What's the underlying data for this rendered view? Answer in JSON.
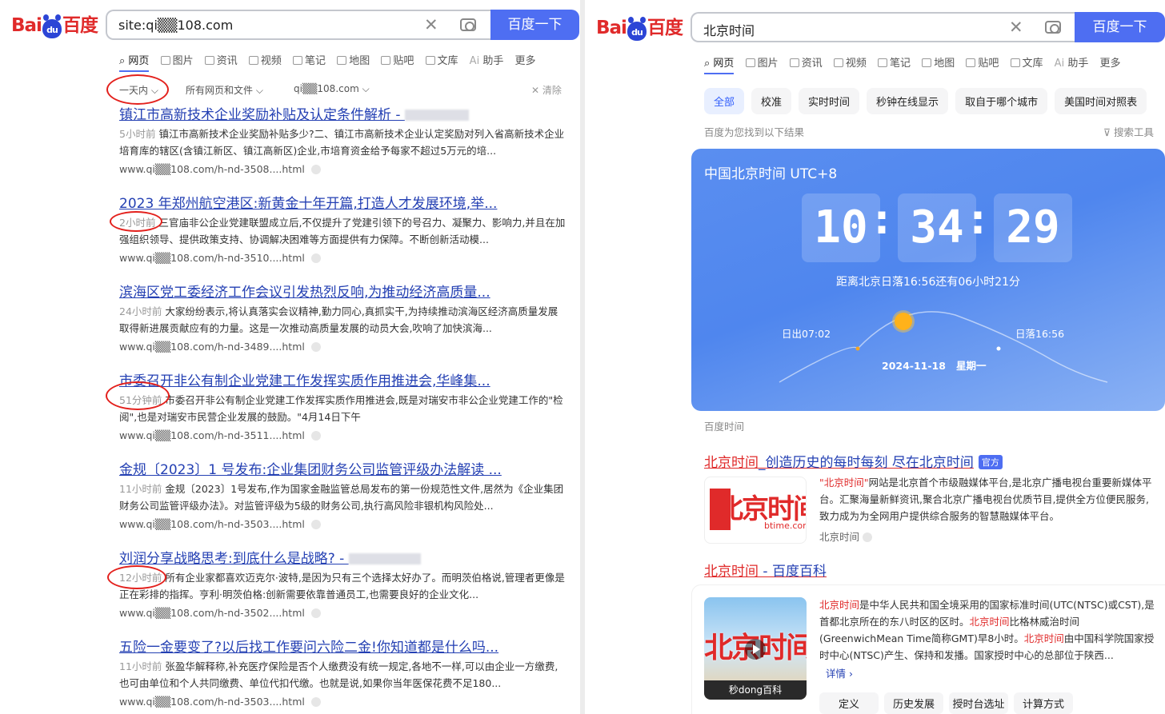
{
  "logo": {
    "part1": "Bai",
    "paw": "du",
    "part2": "百度"
  },
  "left": {
    "query": "site:qi▒▒108.com",
    "search_button": "百度一下",
    "tabs": [
      "网页",
      "图片",
      "资讯",
      "视频",
      "笔记",
      "地图",
      "贴吧",
      "文库",
      "助手",
      "更多"
    ],
    "filters": {
      "time": "一天内",
      "type": "所有网页和文件",
      "site": "qi▒▒108.com",
      "clear": "清除"
    },
    "results": [
      {
        "title": "镇江市高新技术企业奖励补贴及认定条件解析 - ",
        "time": "5小时前",
        "desc": "镇江市高新技术企业奖励补贴多少?二、镇江市高新技术企业认定奖励对列入省高新技术企业培育库的辖区(含镇江新区、镇江高新区)企业,市培育资金给予每家不超过5万元的培...",
        "url": "www.qi▒▒108.com/h-nd-3508....html"
      },
      {
        "title": "2023 年郑州航空港区:新黄金十年开篇,打造人才发展环境,举...",
        "time": "2小时前",
        "desc": "三官庙非公企业党建联盟成立后,不仅提升了党建引领下的号召力、凝聚力、影响力,并且在加强组织领导、提供政策支持、协调解决困难等方面提供有力保障。不断创新活动模...",
        "url": "www.qi▒▒108.com/h-nd-3510....html"
      },
      {
        "title": "滨海区党工委经济工作会议引发热烈反响,为推动经济高质量...",
        "time": "24小时前",
        "desc": "大家纷纷表示,将认真落实会议精神,勤力同心,真抓实干,为持续推动滨海区经济高质量发展取得新进展贡献应有的力量。这是一次推动高质量发展的动员大会,吹响了加快滨海...",
        "url": "www.qi▒▒108.com/h-nd-3489....html"
      },
      {
        "title": "市委召开非公有制企业党建工作发挥实质作用推进会,华峰集...",
        "time": "51分钟前",
        "desc": "市委召开非公有制企业党建工作发挥实质作用推进会,既是对瑞安市非公企业党建工作的\"检阅\",也是对瑞安市民营企业发展的鼓励。\"4月14日下午",
        "url": "www.qi▒▒108.com/h-nd-3511....html"
      },
      {
        "title": "金规〔2023〕1 号发布:企业集团财务公司监管评级办法解读 ...",
        "time": "11小时前",
        "desc": "金规〔2023〕1号发布,作为国家金融监管总局发布的第一份规范性文件,居然为《企业集团财务公司监管评级办法》。对监管评级为5级的财务公司,执行高风险非银机构风险处...",
        "url": "www.qi▒▒108.com/h-nd-3503....html"
      },
      {
        "title": "刘润分享战略思考:到底什么是战略? - ",
        "time": "12小时前",
        "desc": "所有企业家都喜欢迈克尔·波特,是因为只有三个选择太好办了。而明茨伯格说,管理者更像是正在彩排的指挥。亨利·明茨伯格:创新需要依靠普通员工,也需要良好的企业文化...",
        "url": "www.qi▒▒108.com/h-nd-3502....html"
      },
      {
        "title": "五险一金要变了?以后找工作要问六险二金!你知道都是什么吗...",
        "time": "11小时前",
        "desc": "张盈华解释称,补充医疗保险是否个人缴费没有统一规定,各地不一样,可以由企业一方缴费,也可由单位和个人共同缴费、单位代扣代缴。也就是说,如果你当年医保花费不足180...",
        "url": "www.qi▒▒108.com/h-nd-3503....html"
      }
    ]
  },
  "right": {
    "query": "北京时间",
    "search_button": "百度一下",
    "tabs": [
      "网页",
      "图片",
      "资讯",
      "视频",
      "笔记",
      "地图",
      "贴吧",
      "文库",
      "助手",
      "更多"
    ],
    "chips": [
      "全部",
      "校准",
      "实时时间",
      "秒钟在线显示",
      "取自于哪个城市",
      "美国时间对照表"
    ],
    "found": "百度为您找到以下结果",
    "tools": "搜索工具",
    "card": {
      "title": "中国北京时间 UTC+8",
      "hh": "10",
      "mm": "34",
      "ss": "29",
      "sunset_text": "距离北京日落16:56还有06小时21分",
      "sunrise": "日出07:02",
      "sunset": "日落16:56",
      "date": "2024-11-18",
      "weekday": "星期一"
    },
    "card_source": "百度时间",
    "result1": {
      "title_red": "北京时间",
      "title_blue": "_创造历史的每时每刻 尽在北京时间",
      "badge": "官方",
      "logo_text": "北京时间",
      "logo_sub": "btime.com",
      "desc_hl": "\"北京时间\"",
      "desc": "网站是北京首个市级融媒体平台,是北京广播电视台重要新媒体平台。汇聚海量新鲜资讯,聚合北京广播电视台优质节目,提供全方位便民服务,致力成为为全网用户提供综合服务的智慧融媒体平台。",
      "meta": "北京时间"
    },
    "result2": {
      "title_red": "北京时间",
      "title_blue": " - 百度百科",
      "video_text": "北京时间",
      "video_bar": "秒dong百科",
      "hl": "北京时间",
      "desc_a": "是中华人民共和国全境采用的国家标准时间(UTC(NTSC)或CST),是首都北京所在的东八时区的区时。",
      "desc_b": "比格林威治时间(GreenwichMean Time简称GMT)早8小时。",
      "desc_c": "由中国科学院国家授时中心(NTSC)产生、保持和发播。国家授时中心的总部位于陕西...",
      "more": "详情",
      "buttons": [
        "定义",
        "历史发展",
        "授时台选址",
        "计算方式"
      ]
    }
  }
}
